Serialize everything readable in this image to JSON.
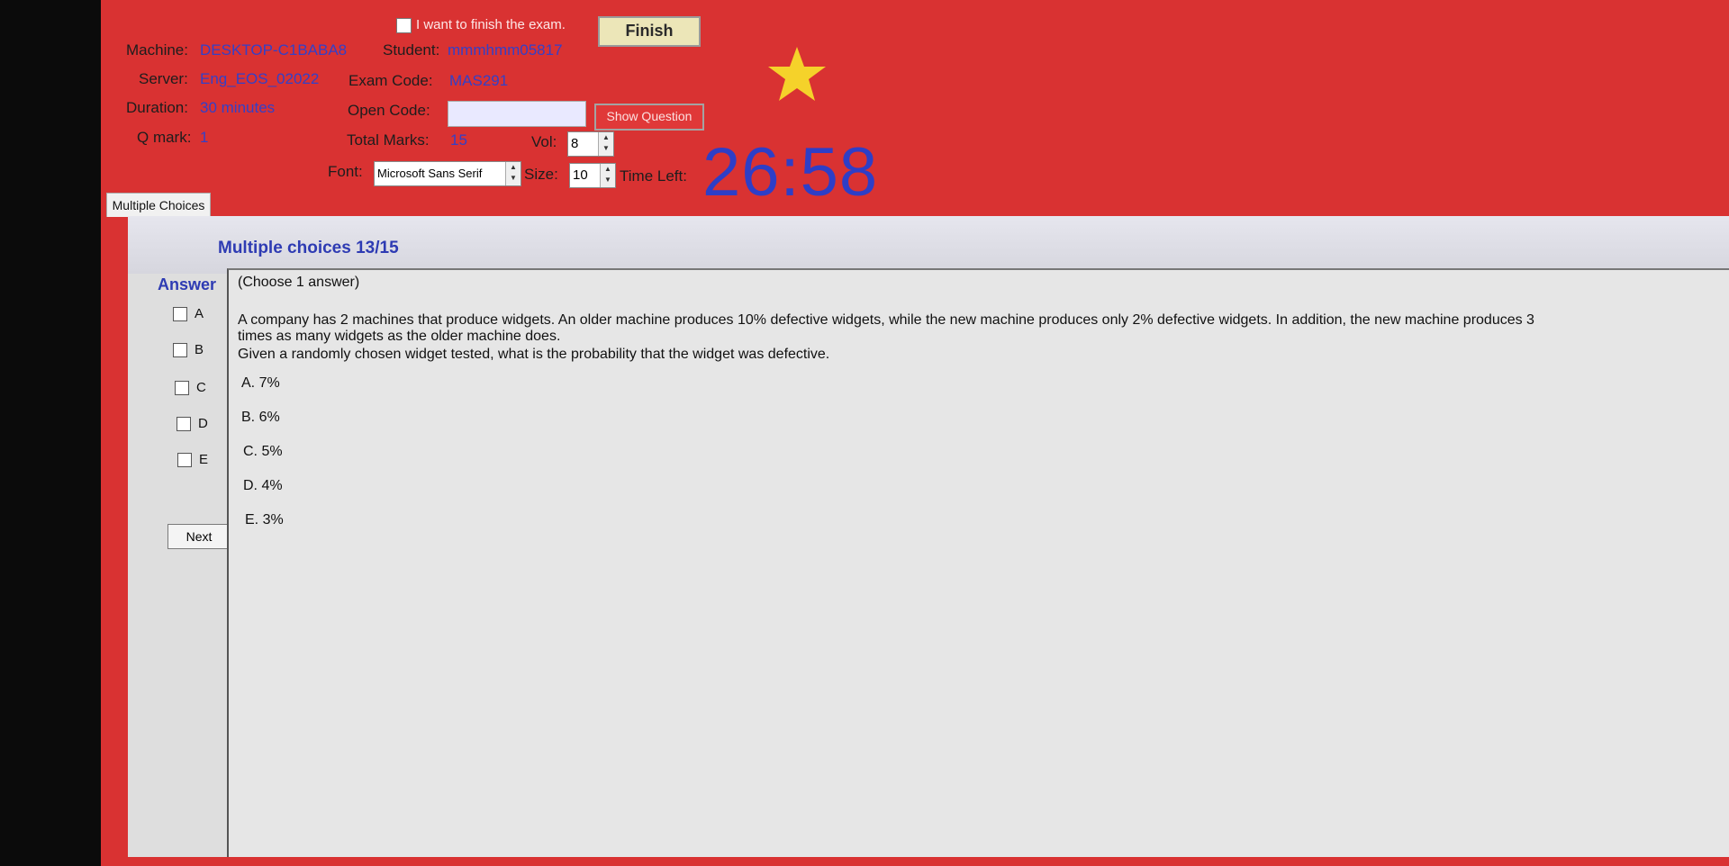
{
  "header": {
    "finish_label": "I want to finish the exam.",
    "finish_button": "Finish",
    "machine_label": "Machine:",
    "machine_value": "DESKTOP-C1BABA8",
    "student_label": "Student:",
    "student_value": "mmmhmm05817",
    "server_label": "Server:",
    "server_value": "Eng_EOS_02022",
    "exam_code_label": "Exam Code:",
    "exam_code_value": "MAS291",
    "duration_label": "Duration:",
    "duration_value": "30 minutes",
    "open_code_label": "Open Code:",
    "show_question_button": "Show Question",
    "qmark_label": "Q mark:",
    "qmark_value": "1",
    "total_marks_label": "Total Marks:",
    "total_marks_value": "15",
    "vol_label": "Vol:",
    "vol_value": "8",
    "font_label": "Font:",
    "font_value": "Microsoft Sans Serif",
    "size_label": "Size:",
    "size_value": "10",
    "time_left_label": "Time Left:",
    "time_left_value": "26:58"
  },
  "tabs": {
    "multiple_choices": "Multiple Choices"
  },
  "panel": {
    "title": "Multiple choices 13/15",
    "answer_label": "Answer",
    "choices": [
      "A",
      "B",
      "C",
      "D",
      "E"
    ],
    "next_button": "Next"
  },
  "question": {
    "instruction": "(Choose 1 answer)",
    "line1": "A company has 2 machines that produce widgets. An older machine produces 10% defective widgets, while the new machine produces only 2% defective widgets. In addition, the new machine produces 3",
    "line2": "times as many widgets as the older machine does.",
    "line3": "Given a randomly chosen widget tested, what is the probability that the widget was defective.",
    "options": [
      "A. 7%",
      "B. 6%",
      "C. 5%",
      "D. 4%",
      "E. 3%"
    ]
  },
  "colors": {
    "background": "#d93232",
    "value_blue": "#3340c8",
    "timer": "#2e3ec7",
    "star": "#f5d22a"
  },
  "icons": {
    "star": "star-icon",
    "spinner": "spinner-arrows-icon"
  }
}
